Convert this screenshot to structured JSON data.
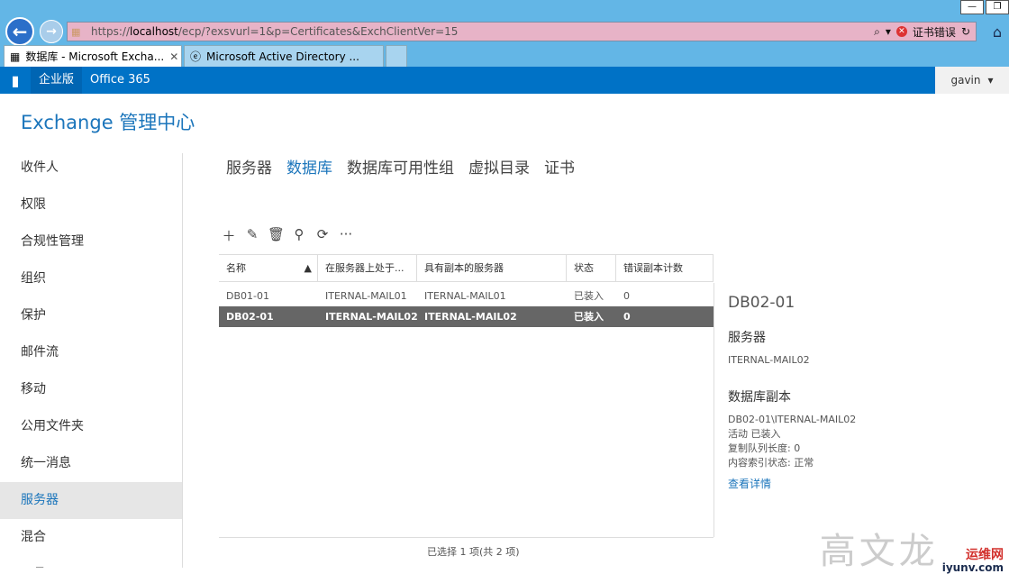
{
  "browser": {
    "url_prefix": "https://",
    "url_host": "localhost",
    "url_rest": "/ecp/?exsvurl=1&p=Certificates&ExchClientVer=15",
    "cert_error": "证书错误",
    "tabs": [
      {
        "label": "数据库 - Microsoft Excha..."
      },
      {
        "label": "Microsoft Active Directory ..."
      }
    ]
  },
  "o365": {
    "items": [
      "企业版",
      "Office 365"
    ],
    "user": "gavin"
  },
  "app_title": "Exchange 管理中心",
  "nav": {
    "items": [
      "收件人",
      "权限",
      "合规性管理",
      "组织",
      "保护",
      "邮件流",
      "移动",
      "公用文件夹",
      "统一消息",
      "服务器",
      "混合",
      "工具"
    ],
    "selected": "服务器"
  },
  "subtabs": [
    "服务器",
    "数据库",
    "数据库可用性组",
    "虚拟目录",
    "证书"
  ],
  "table": {
    "columns": [
      "名称",
      "在服务器上处于...",
      "具有副本的服务器",
      "状态",
      "错误副本计数"
    ],
    "rows": [
      [
        "DB01-01",
        "ITERNAL-MAIL01",
        "ITERNAL-MAIL01",
        "已装入",
        "0"
      ],
      [
        "DB02-01",
        "ITERNAL-MAIL02",
        "ITERNAL-MAIL02",
        "已装入",
        "0"
      ]
    ],
    "count_text": "已选择 1 项(共 2 项)"
  },
  "details": {
    "title": "DB02-01",
    "server_heading": "服务器",
    "server": "ITERNAL-MAIL02",
    "copy_heading": "数据库副本",
    "copy_name": "DB02-01\\ITERNAL-MAIL02",
    "copy_status": "活动 已装入",
    "queue": "复制队列长度: 0",
    "index": "内容索引状态: 正常",
    "link": "查看详情"
  },
  "watermark": {
    "text": "高文龙",
    "site_name": "运维网",
    "site_url": "iyunv.com"
  }
}
